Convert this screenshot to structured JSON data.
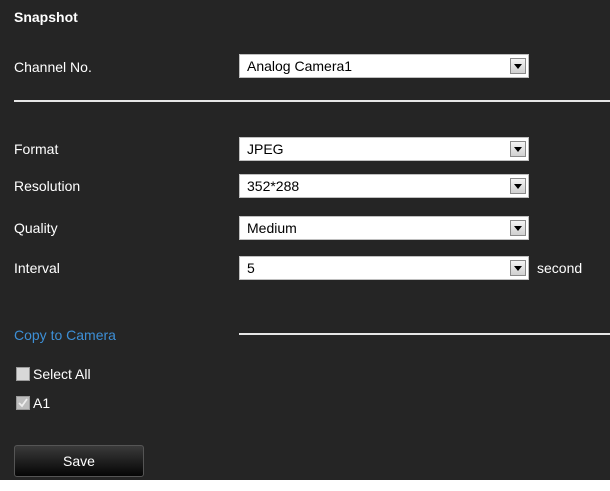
{
  "title": "Snapshot",
  "channel": {
    "label": "Channel No.",
    "value": "Analog Camera1"
  },
  "format": {
    "label": "Format",
    "value": "JPEG"
  },
  "resolution": {
    "label": "Resolution",
    "value": "352*288"
  },
  "quality": {
    "label": "Quality",
    "value": "Medium"
  },
  "interval": {
    "label": "Interval",
    "value": "5",
    "unit": "second"
  },
  "copy_section": {
    "label": "Copy to Camera",
    "select_all": {
      "label": "Select All",
      "checked": false
    },
    "cameras": [
      {
        "label": "A1",
        "checked": true
      }
    ]
  },
  "save_label": "Save",
  "colors": {
    "panel_bg": "#252525",
    "link": "#3d8fd6",
    "divider": "#e6e6e6"
  }
}
